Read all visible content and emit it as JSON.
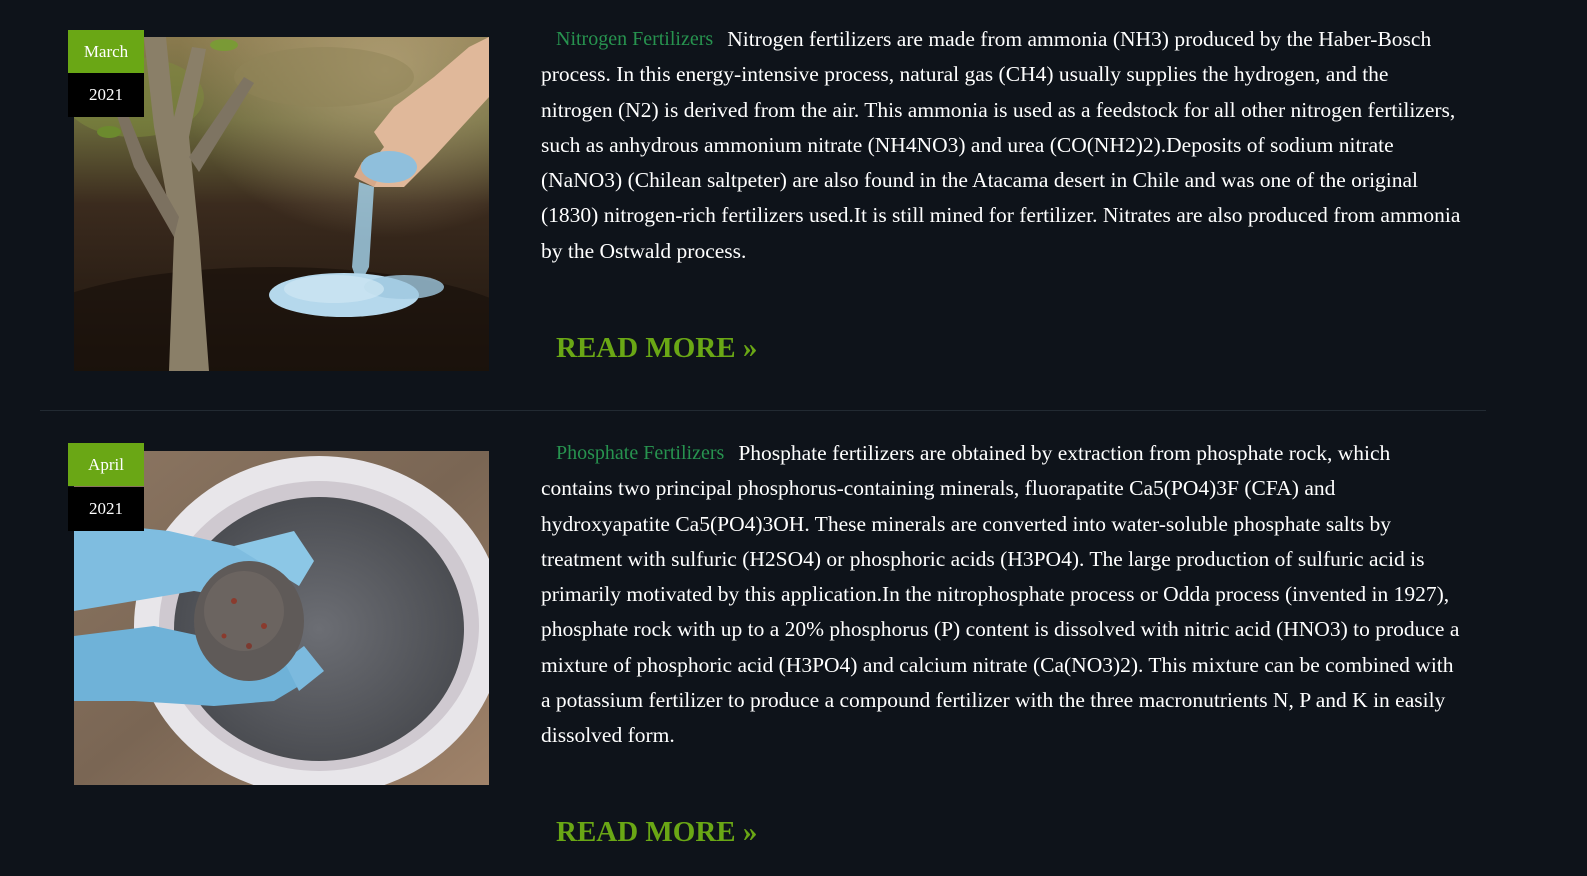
{
  "posts": [
    {
      "date_month": "March",
      "date_year": "2021",
      "title": "Nitrogen Fertilizers",
      "body": "Nitrogen fertilizers are made from ammonia (NH3) produced by the Haber-Bosch process. In this energy-intensive process, natural gas (CH4) usually supplies the hydrogen, and the nitrogen (N2) is derived from the air. This ammonia is used as a feedstock for all other nitrogen fertilizers, such as anhydrous ammonium nitrate (NH4NO3) and urea (CO(NH2)2).Deposits of sodium nitrate (NaNO3) (Chilean saltpeter) are also found in the Atacama desert in Chile and was one of the original (1830) nitrogen-rich fertilizers used.It is still mined for fertilizer. Nitrates are also produced from ammonia by the Ostwald process.",
      "read_more": "READ MORE »"
    },
    {
      "date_month": "April",
      "date_year": "2021",
      "title": "Phosphate Fertilizers",
      "body": "Phosphate fertilizers are obtained by extraction from phosphate rock, which contains two principal phosphorus-containing minerals, fluorapatite Ca5(PO4)3F (CFA) and hydroxyapatite Ca5(PO4)3OH. These minerals are converted into water-soluble phosphate salts by treatment with sulfuric (H2SO4) or phosphoric acids (H3PO4). The large production of sulfuric acid is primarily motivated by this application.In the nitrophosphate process or Odda process (invented in 1927), phosphate rock with up to a 20% phosphorus (P) content is dissolved with nitric acid (HNO3) to produce a mixture of phosphoric acid (H3PO4) and calcium nitrate (Ca(NO3)2). This mixture can be combined with a potassium fertilizer to produce a compound fertilizer with the three macronutrients N, P and K in easily dissolved form.",
      "read_more": "READ MORE »"
    }
  ],
  "colors": {
    "background": "#0e131a",
    "accent_green": "#6aa715",
    "title_green": "#27934f",
    "date_year_bg": "#000000"
  }
}
